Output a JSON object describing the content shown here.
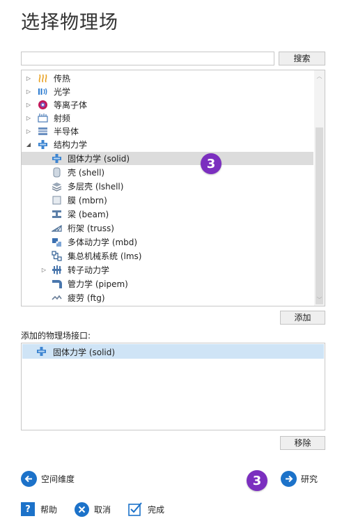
{
  "title": "选择物理场",
  "search": {
    "value": "",
    "button_label": "搜索"
  },
  "tree": {
    "items": [
      {
        "label": "传热",
        "icon": "heat-transfer-icon",
        "expanded": false
      },
      {
        "label": "光学",
        "icon": "optics-icon",
        "expanded": false
      },
      {
        "label": "等离子体",
        "icon": "plasma-icon",
        "expanded": false
      },
      {
        "label": "射频",
        "icon": "radio-frequency-icon",
        "expanded": false
      },
      {
        "label": "半导体",
        "icon": "semiconductor-icon",
        "expanded": false
      },
      {
        "label": "结构力学",
        "icon": "structural-mechanics-icon",
        "expanded": true
      },
      {
        "label": "固体力学 (solid)",
        "icon": "solid-mechanics-icon",
        "selected": true
      },
      {
        "label": "壳 (shell)",
        "icon": "shell-icon"
      },
      {
        "label": "多层壳 (lshell)",
        "icon": "layered-shell-icon"
      },
      {
        "label": "膜 (mbrn)",
        "icon": "membrane-icon"
      },
      {
        "label": "梁 (beam)",
        "icon": "beam-icon"
      },
      {
        "label": "桁架 (truss)",
        "icon": "truss-icon"
      },
      {
        "label": "多体动力学 (mbd)",
        "icon": "multibody-dynamics-icon"
      },
      {
        "label": "集总机械系统 (lms)",
        "icon": "lumped-mechanical-system-icon"
      },
      {
        "label": "转子动力学",
        "icon": "rotordynamics-icon",
        "expanded": false
      },
      {
        "label": "管力学 (pipem)",
        "icon": "pipe-mechanics-icon"
      },
      {
        "label": "疲劳 (ftg)",
        "icon": "fatigue-icon"
      }
    ]
  },
  "badge_number": "3",
  "add_button_label": "添加",
  "added_interfaces": {
    "label": "添加的物理场接口:",
    "items": [
      {
        "label": "固体力学 (solid)",
        "icon": "solid-mechanics-icon"
      }
    ]
  },
  "remove_button_label": "移除",
  "nav": {
    "back_label": "空间维度",
    "next_label": "研究"
  },
  "footer": {
    "help_label": "帮助",
    "cancel_label": "取消",
    "done_label": "完成"
  },
  "colors": {
    "accent_blue": "#1c72c9",
    "badge_purple": "#7b2fbf",
    "selected_row": "#cfe4f6"
  }
}
